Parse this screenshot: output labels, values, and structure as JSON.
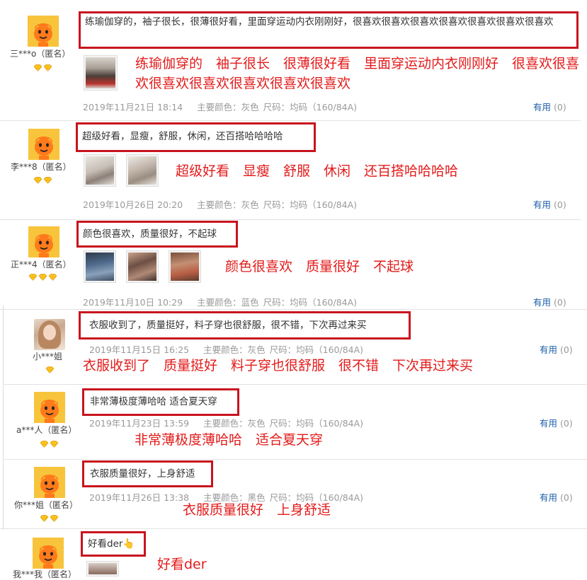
{
  "reviews": [
    {
      "user": "三***o（匿名）",
      "comment": "练瑜伽穿的，袖子很长，很薄很好看，里面穿运动内衣刚刚好，很喜欢很喜欢很喜欢很喜欢很喜欢很喜欢很喜欢",
      "annotation": "练瑜伽穿的　袖子很长　很薄很好看　里面穿运动内衣刚刚好　很喜欢很喜欢很喜欢很喜欢很喜欢很喜欢很喜欢",
      "date": "2019年11月21日 18:14",
      "color_label": "主要颜色：灰色",
      "size_label": "尺码：均码（160/84A)",
      "useful_label": "有用",
      "useful_count": "(0)",
      "rank": 2
    },
    {
      "user": "李***8（匿名）",
      "comment": "超级好看，显瘦，舒服，休闲，还百搭哈哈哈哈",
      "annotation": "超级好看　显瘦　舒服　休闲　还百搭哈哈哈哈",
      "date": "2019年10月26日 20:20",
      "color_label": "主要颜色：灰色",
      "size_label": "尺码：均码（160/84A)",
      "useful_label": "有用",
      "useful_count": "(0)",
      "rank": 2
    },
    {
      "user": "正***4（匿名）",
      "comment": "颜色很喜欢，质量很好，不起球",
      "annotation": "颜色很喜欢　质量很好　不起球",
      "date": "2019年11月10日 10:29",
      "color_label": "主要颜色：蓝色",
      "size_label": "尺码：均码（160/84A)",
      "useful_label": "有用",
      "useful_count": "(0)",
      "rank": 3
    },
    {
      "user": "小***姐",
      "comment": "衣服收到了，质量挺好，料子穿也很舒服，很不错，下次再过来买",
      "annotation": "衣服收到了　质量挺好　料子穿也很舒服　很不错　下次再过来买",
      "date": "2019年11月15日 16:25",
      "color_label": "主要颜色：灰色",
      "size_label": "尺码：均码（160/84A)",
      "useful_label": "有用",
      "useful_count": "(0)",
      "rank": 1
    },
    {
      "user": "a***人（匿名）",
      "comment": "非常薄极度薄哈哈 适合夏天穿",
      "annotation": "非常薄极度薄哈哈　适合夏天穿",
      "date": "2019年11月23日 13:59",
      "color_label": "主要颜色：灰色",
      "size_label": "尺码：均码（160/84A)",
      "useful_label": "有用",
      "useful_count": "(0)",
      "rank": 2
    },
    {
      "user": "你***姐（匿名）",
      "comment": "衣服质量很好，上身舒适",
      "annotation": "衣服质量很好　上身舒适",
      "date": "2019年11月26日 13:38",
      "color_label": "主要颜色：黑色",
      "size_label": "尺码：均码（160/84A)",
      "useful_label": "有用",
      "useful_count": "(0)",
      "rank": 2
    },
    {
      "user": "我***我（匿名）",
      "comment": "好看der👆",
      "annotation": "好看der"
    }
  ],
  "colors": {
    "annotation_red": "#e31b1b",
    "box_red": "#c8141e",
    "link_blue": "#1a5ea8",
    "meta_gray": "#9a9a9a"
  },
  "icons": {
    "avatar": "taobao-mascot-icon",
    "rank": "diamond-icon",
    "pointer": "hand-pointer-emoji"
  }
}
